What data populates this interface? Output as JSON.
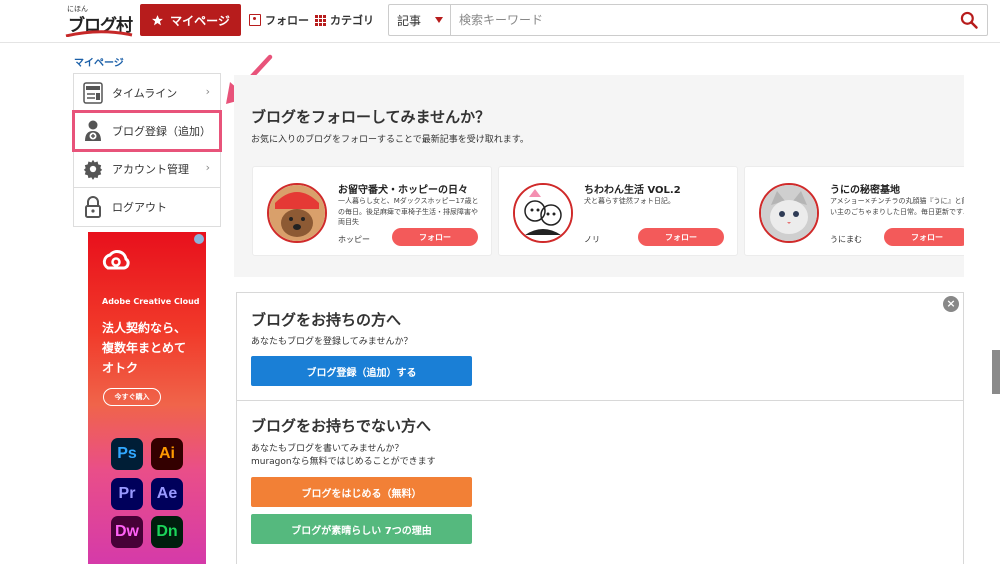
{
  "header": {
    "logo_small": "にほん",
    "logo_main": "ブログ村",
    "mypage_label": "マイページ",
    "follow_label": "フォロー",
    "category_label": "カテゴリ",
    "search_scope": "記事",
    "search_placeholder": "検索キーワード"
  },
  "sidebar": {
    "title": "マイページ",
    "items": [
      {
        "label": "タイムライン",
        "icon": "reader-icon",
        "chevron": "›"
      },
      {
        "label": "ブログ登録（追加）",
        "icon": "user-add-icon",
        "highlighted": true
      },
      {
        "label": "アカウント管理",
        "icon": "gear-icon",
        "chevron": "›"
      },
      {
        "label": "ログアウト",
        "icon": "lock-icon"
      }
    ]
  },
  "ad": {
    "brand": "Adobe Creative Cloud",
    "copy_line1": "法人契約なら、",
    "copy_line2": "複数年まとめて",
    "copy_line3": "オトク",
    "cta": "今すぐ購入",
    "apps": [
      "Ps",
      "Ai",
      "Pr",
      "Ae",
      "Dw",
      "Dn"
    ]
  },
  "suggest": {
    "title": "ブログをフォローしてみませんか？",
    "subtitle": "お気に入りのブログをフォローすることで最新記事を受け取れます。",
    "follow_label": "フォロー",
    "cards": [
      {
        "name": "お留守番犬・ホッピーの日々",
        "desc": "一人暮らし女と、Mダックスホッピー17歳との毎日。後足麻痺で車椅子生活・排尿障害や両目失",
        "user": "ホッピー"
      },
      {
        "name": "ちわわん生活 VOL.2",
        "desc": "犬と暮らす徒然フォト日記。",
        "user": "ノリ"
      },
      {
        "name": "うにの秘密基地",
        "desc": "アメショー×チンチラの丸顔猫『うに』と飼い主のごちゃまりした日常。毎日更新です♪",
        "user": "うにまむ"
      }
    ]
  },
  "owner": {
    "close": "×",
    "has_blog_title": "ブログをお持ちの方へ",
    "has_blog_text": "あなたもブログを登録してみませんか？",
    "register_btn": "ブログ登録（追加）する",
    "no_blog_title": "ブログをお持ちでない方へ",
    "no_blog_text1": "あなたもブログを書いてみませんか？",
    "no_blog_text2": "muragonなら無料ではじめることができます",
    "start_btn": "ブログをはじめる（無料）",
    "reasons_btn": "ブログが素晴らしい 7つの理由"
  },
  "colors": {
    "brand_red": "#b71c1c",
    "highlight": "#e8537a",
    "follow_btn": "#f35a5a",
    "blue_btn": "#1a7fd6",
    "orange_btn": "#f28036",
    "green_btn": "#55b97e"
  }
}
